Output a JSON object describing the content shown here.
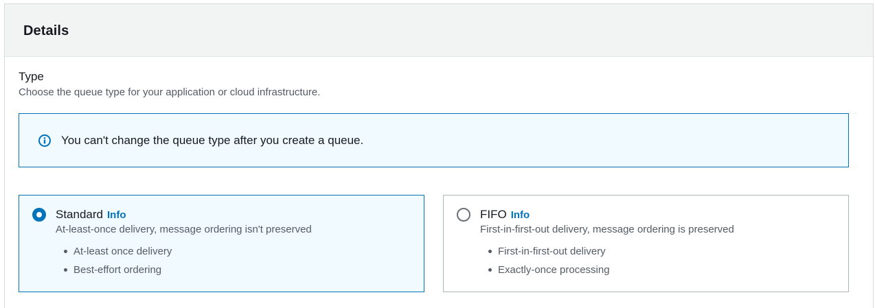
{
  "panel": {
    "title": "Details"
  },
  "type_field": {
    "label": "Type",
    "description": "Choose the queue type for your application or cloud infrastructure."
  },
  "alert": {
    "icon": "info-circle-icon",
    "text": "You can't change the queue type after you create a queue."
  },
  "options": [
    {
      "title": "Standard",
      "info": "Info",
      "selected": true,
      "description": "At-least-once delivery, message ordering isn't preserved",
      "features": [
        "At-least once delivery",
        "Best-effort ordering"
      ]
    },
    {
      "title": "FIFO",
      "info": "Info",
      "selected": false,
      "description": "First-in-first-out delivery, message ordering is preserved",
      "features": [
        "First-in-first-out delivery",
        "Exactly-once processing"
      ]
    }
  ],
  "colors": {
    "accent": "#0073bb",
    "selected_bg": "#f1faff",
    "header_bg": "#f2f3f3",
    "text_primary": "#16191f",
    "text_secondary": "#545b64"
  }
}
